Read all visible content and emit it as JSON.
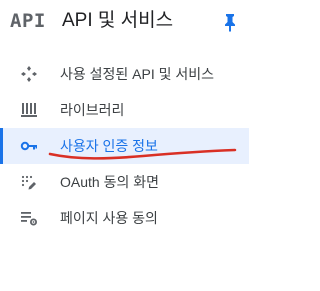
{
  "header": {
    "logo_text": "API",
    "title": "API 및 서비스",
    "pin_icon": "pin-icon"
  },
  "nav": {
    "items": [
      {
        "label": "사용 설정된 API 및 서비스",
        "icon": "api-diamond-icon",
        "active": false
      },
      {
        "label": "라이브러리",
        "icon": "library-icon",
        "active": false
      },
      {
        "label": "사용자 인증 정보",
        "icon": "key-icon",
        "active": true
      },
      {
        "label": "OAuth 동의 화면",
        "icon": "oauth-consent-icon",
        "active": false
      },
      {
        "label": "페이지 사용 동의",
        "icon": "page-usage-agreement-icon",
        "active": false
      }
    ]
  },
  "colors": {
    "accent": "#1a73e8",
    "active_bg": "#e8f0fe",
    "text": "#3c4043",
    "icon": "#5f6368",
    "annotation": "#d93025"
  }
}
